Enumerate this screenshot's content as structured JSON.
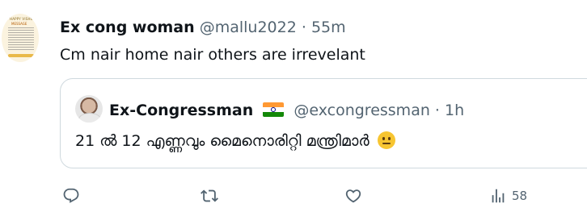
{
  "tweet": {
    "author_name": "Ex cong woman",
    "author_handle": "@mallu2022",
    "separator": "·",
    "time": "55m",
    "text": "Cm nair home nair others are irrevelant",
    "avatar_poster_title": "HAPPY VISHU",
    "avatar_poster_sub": "MESSAGE"
  },
  "quote": {
    "author_name": "Ex-Congressman",
    "author_handle": "@excongressman",
    "separator": "·",
    "time": "1h",
    "text": "21 ൽ 12 എണ്ണവും മൈനൊരിറ്റി മന്ത്രിമാർ",
    "flag_icon": "india-flag-icon",
    "emoji_icon": "neutral-face-emoji"
  },
  "actions": {
    "views_count": "58"
  },
  "colors": {
    "text_primary": "#0f1419",
    "text_secondary": "#536471",
    "border": "#cfd9de"
  }
}
